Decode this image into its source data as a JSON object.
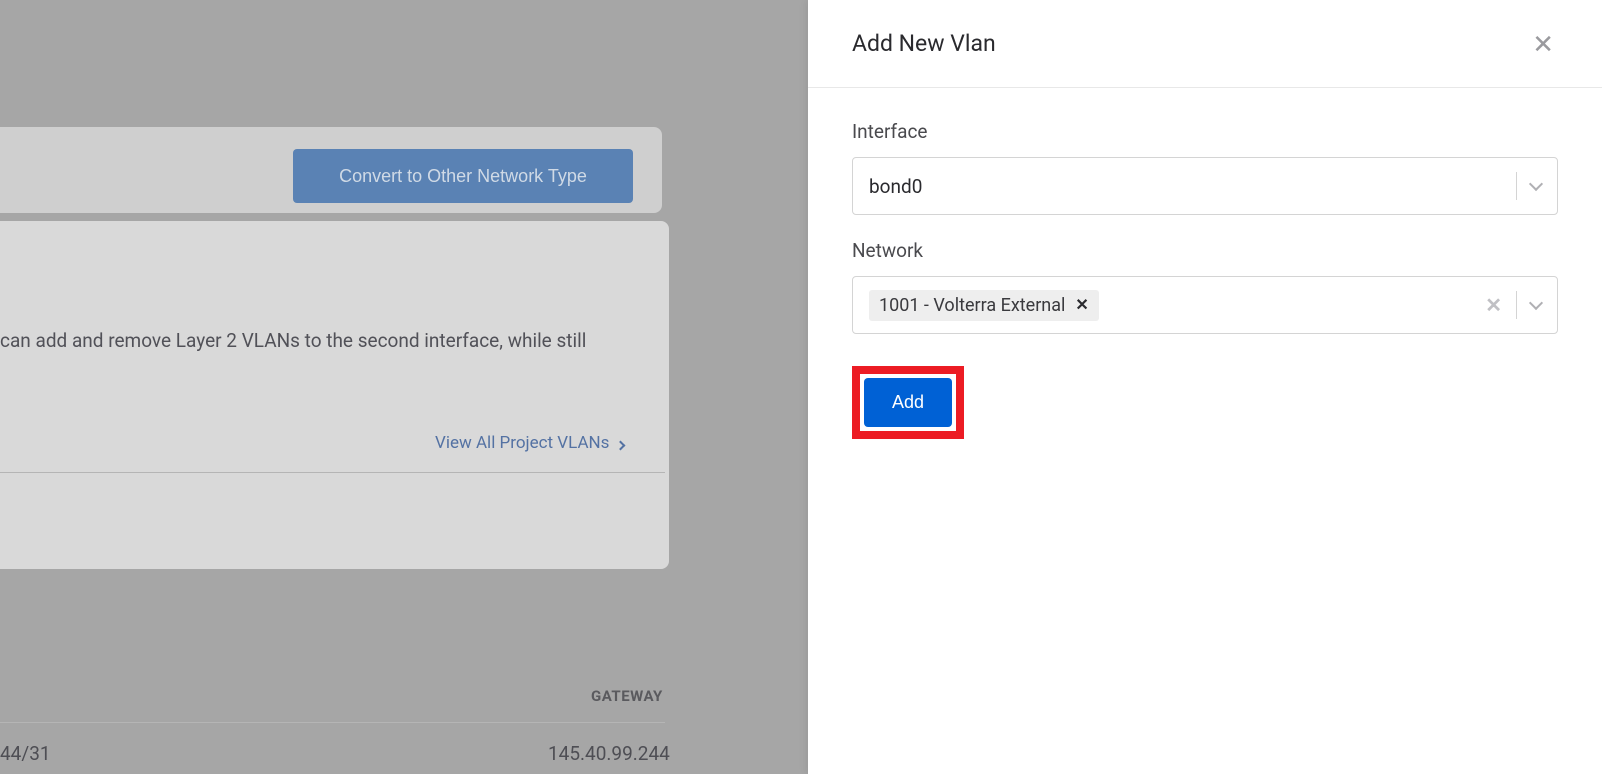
{
  "background": {
    "convert_button_label": "Convert to Other Network Type",
    "description_text": "can add and remove Layer 2 VLANs to the second interface, while still",
    "view_all_link": "View All Project VLANs",
    "gateway_label": "GATEWAY",
    "ip_partial": "44/31",
    "ip_gateway": "145.40.99.244"
  },
  "panel": {
    "title": "Add New Vlan",
    "interface_label": "Interface",
    "interface_value": "bond0",
    "network_label": "Network",
    "network_selected": "1001 - Volterra External",
    "add_button_label": "Add"
  }
}
